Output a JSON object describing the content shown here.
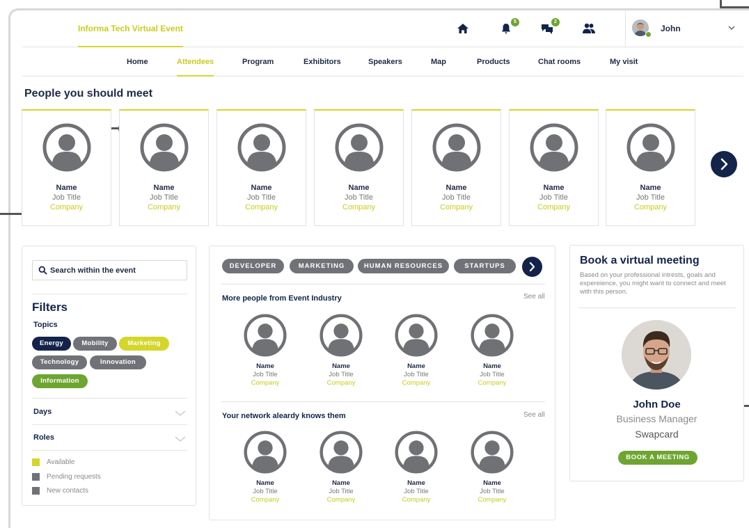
{
  "header": {
    "event_name": "Informa Tech Virtual Event",
    "notifications_count": "5",
    "messages_count": "2",
    "user_name": "John",
    "icons": [
      "home-icon",
      "bell-icon",
      "chat-icon",
      "people-icon",
      "chevron-down-icon"
    ]
  },
  "nav": {
    "items": [
      {
        "label": "Home"
      },
      {
        "label": "Attendees"
      },
      {
        "label": "Program"
      },
      {
        "label": "Exhibitors"
      },
      {
        "label": "Speakers"
      },
      {
        "label": "Map"
      },
      {
        "label": "Products"
      },
      {
        "label": "Chat rooms"
      },
      {
        "label": "My visit"
      }
    ],
    "active": "Attendees"
  },
  "suggestions": {
    "title": "People you should meet",
    "people": [
      {
        "name": "Name",
        "job": "Job Title",
        "company": "Company"
      },
      {
        "name": "Name",
        "job": "Job Title",
        "company": "Company"
      },
      {
        "name": "Name",
        "job": "Job Title",
        "company": "Company"
      },
      {
        "name": "Name",
        "job": "Job Title",
        "company": "Company"
      },
      {
        "name": "Name",
        "job": "Job Title",
        "company": "Company"
      },
      {
        "name": "Name",
        "job": "Job Title",
        "company": "Company"
      },
      {
        "name": "Name",
        "job": "Job Title",
        "company": "Company"
      }
    ]
  },
  "filters": {
    "search_placeholder": "Search within the event",
    "title": "Filters",
    "topics_label": "Topics",
    "topics": [
      {
        "label": "Energy",
        "color": "#13234a"
      },
      {
        "label": "Mobility",
        "color": "#707278"
      },
      {
        "label": "Marketing",
        "color": "#d4d62a"
      },
      {
        "label": "Technology",
        "color": "#707278"
      },
      {
        "label": "Innovation",
        "color": "#707278"
      },
      {
        "label": "Information",
        "color": "#6ea531"
      }
    ],
    "days_label": "Days",
    "roles_label": "Roles",
    "legend": [
      {
        "label": "Available",
        "color": "#d4d62a"
      },
      {
        "label": "Pending requests",
        "color": "#707278"
      },
      {
        "label": "New contacts",
        "color": "#707278"
      }
    ]
  },
  "middle": {
    "tags": [
      "DEVELOPER",
      "MARKETING",
      "HUMAN RESOURCES",
      "STARTUPS"
    ],
    "section1": {
      "title": "More people from Event Industry",
      "see_all": "See all",
      "people": [
        {
          "name": "Name",
          "job": "Job Title",
          "company": "Company"
        },
        {
          "name": "Name",
          "job": "Job Title",
          "company": "Company"
        },
        {
          "name": "Name",
          "job": "Job Title",
          "company": "Company"
        },
        {
          "name": "Name",
          "job": "Job Title",
          "company": "Company"
        }
      ]
    },
    "section2": {
      "title": "Your network aleardy knows them",
      "see_all": "See all",
      "people": [
        {
          "name": "Name",
          "job": "Job Title",
          "company": "Company"
        },
        {
          "name": "Name",
          "job": "Job Title",
          "company": "Company"
        },
        {
          "name": "Name",
          "job": "Job Title",
          "company": "Company"
        },
        {
          "name": "Name",
          "job": "Job Title",
          "company": "Company"
        }
      ]
    }
  },
  "booking": {
    "title": "Book a virtual meeting",
    "description": "Based on your professional intrests, goals and expereience, you might want to connect and meet with this person.",
    "name": "John Doe",
    "role": "Business Manager",
    "company": "Swapcard",
    "button": "BOOK A MEETING"
  },
  "colors": {
    "accent_yellow": "#d4d62a",
    "navy": "#13234a",
    "green": "#6ea531",
    "gray": "#707278"
  }
}
